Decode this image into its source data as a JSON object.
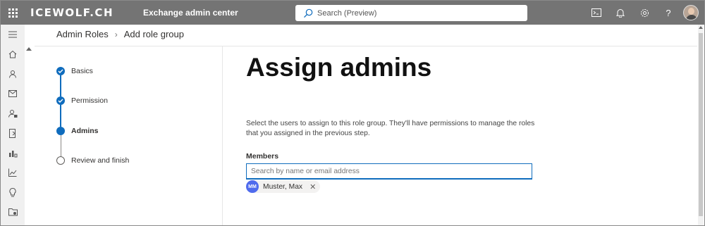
{
  "header": {
    "logo": "ICEWOLF.CH",
    "app_title": "Exchange admin center",
    "search_placeholder": "Search (Preview)"
  },
  "breadcrumb": {
    "parent": "Admin Roles",
    "separator": ">",
    "current": "Add role group"
  },
  "steps": [
    {
      "label": "Basics",
      "state": "done"
    },
    {
      "label": "Permission",
      "state": "done"
    },
    {
      "label": "Admins",
      "state": "current"
    },
    {
      "label": "Review and finish",
      "state": "todo"
    }
  ],
  "main": {
    "title": "Assign admins",
    "description": "Select the users to assign to this role group. They'll have permissions to manage the roles that you assigned in the previous step.",
    "members_label": "Members",
    "members_placeholder": "Search by name or email address",
    "selected_members": [
      {
        "initials": "MM",
        "name": "Muster, Max"
      }
    ]
  },
  "colors": {
    "topbar": "#747474",
    "accent": "#0f6cbd",
    "avatar_badge": "#4f6bed"
  }
}
